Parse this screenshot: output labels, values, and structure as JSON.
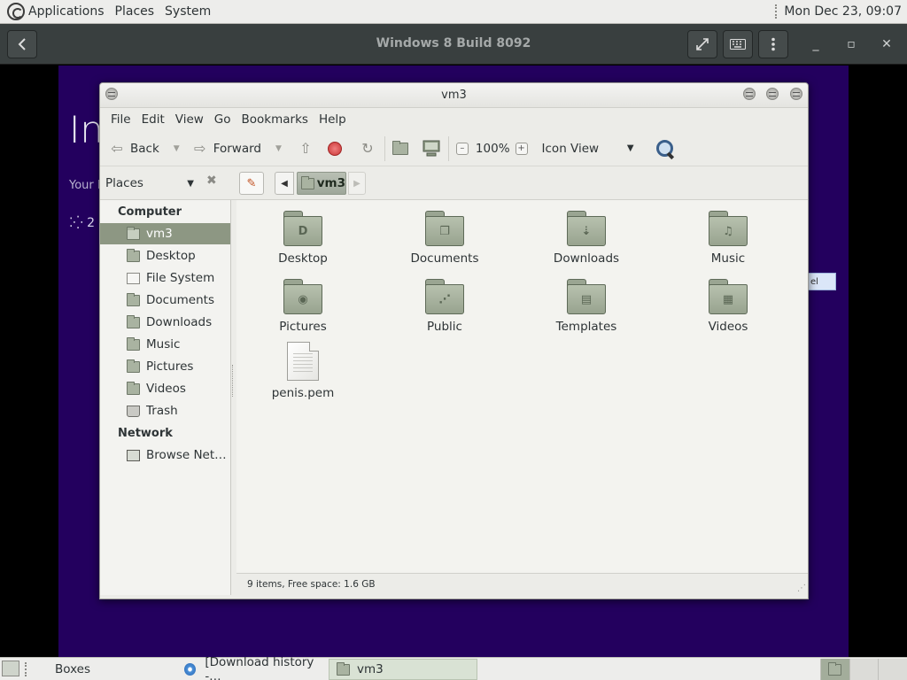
{
  "top_panel": {
    "menus": [
      "Applications",
      "Places",
      "System"
    ],
    "clock": "Mon Dec 23, 09:07"
  },
  "boxes": {
    "title": "Windows 8 Build 8092",
    "back_icon": "chevron-left-icon",
    "fullscreen_icon": "fullscreen-icon",
    "keys_icon": "keyboard-icon",
    "props_icon": "vertical-dots-icon",
    "minimize": "_",
    "maximize": "▫",
    "close": "✕"
  },
  "guest": {
    "heading": "In",
    "subtext": "Your P",
    "spinner_text": "2",
    "button_text": "el"
  },
  "file_manager": {
    "title": "vm3",
    "menu": [
      "File",
      "Edit",
      "View",
      "Go",
      "Bookmarks",
      "Help"
    ],
    "toolbar": {
      "back": "Back",
      "forward": "Forward",
      "zoom": "100%",
      "view_mode": "Icon View"
    },
    "location": {
      "places_label": "Places",
      "crumb": "vm3"
    },
    "sidebar": {
      "computer_heading": "Computer",
      "computer_items": [
        {
          "label": "vm3",
          "icon": "home-folder-icon",
          "selected": true
        },
        {
          "label": "Desktop",
          "icon": "folder-icon"
        },
        {
          "label": "File System",
          "icon": "drive-icon"
        },
        {
          "label": "Documents",
          "icon": "folder-icon"
        },
        {
          "label": "Downloads",
          "icon": "folder-icon"
        },
        {
          "label": "Music",
          "icon": "folder-icon"
        },
        {
          "label": "Pictures",
          "icon": "folder-icon"
        },
        {
          "label": "Videos",
          "icon": "folder-icon"
        },
        {
          "label": "Trash",
          "icon": "trash-icon"
        }
      ],
      "network_heading": "Network",
      "network_items": [
        {
          "label": "Browse Net…",
          "icon": "network-icon"
        }
      ]
    },
    "files": [
      {
        "name": "Desktop",
        "type": "folder",
        "emblem": "D"
      },
      {
        "name": "Documents",
        "type": "folder",
        "emblem": "❐"
      },
      {
        "name": "Downloads",
        "type": "folder",
        "emblem": "⇣"
      },
      {
        "name": "Music",
        "type": "folder",
        "emblem": "♫"
      },
      {
        "name": "Pictures",
        "type": "folder",
        "emblem": "◉"
      },
      {
        "name": "Public",
        "type": "folder",
        "emblem": "⋰"
      },
      {
        "name": "Templates",
        "type": "folder",
        "emblem": "▤"
      },
      {
        "name": "Videos",
        "type": "folder",
        "emblem": "▦"
      },
      {
        "name": "penis.pem",
        "type": "file",
        "emblem": ""
      }
    ],
    "status": "9 items, Free space: 1.6 GB"
  },
  "taskbar": {
    "items": [
      {
        "label": "Boxes",
        "icon": "boxes-icon"
      },
      {
        "label": "[Download history -…",
        "icon": "browser-icon"
      },
      {
        "label": "vm3",
        "icon": "home-folder-icon",
        "active": true
      }
    ]
  }
}
